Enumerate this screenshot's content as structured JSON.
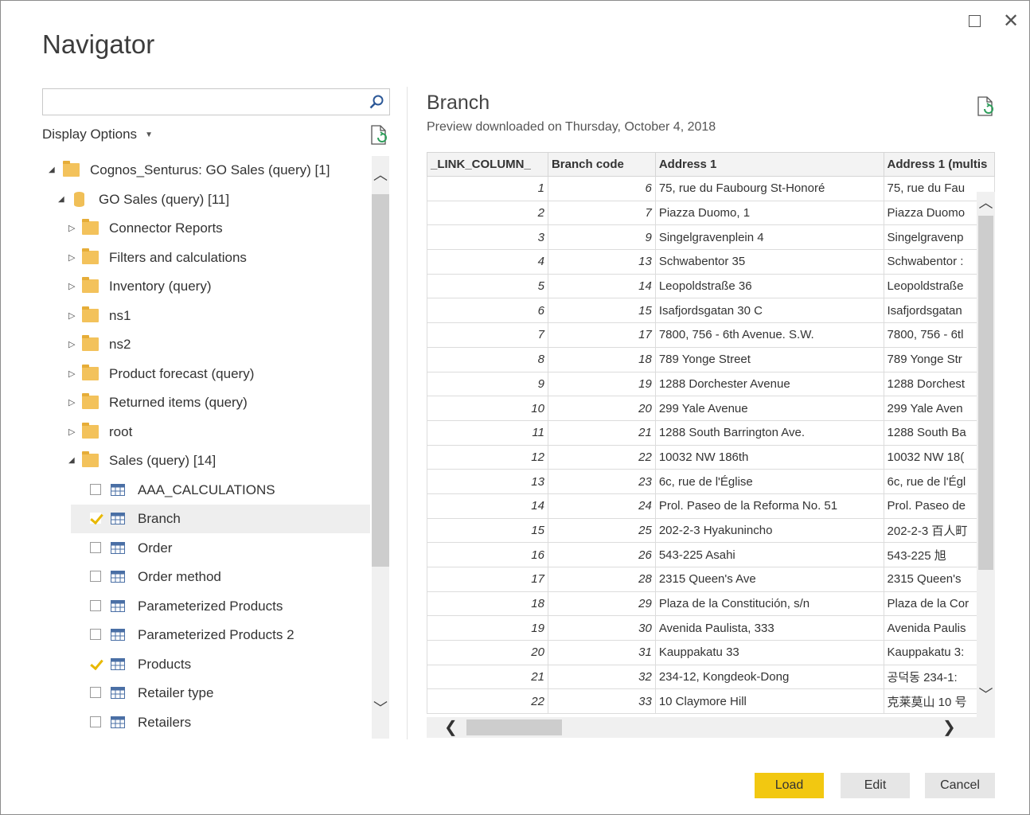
{
  "window": {
    "title": "Navigator",
    "maximize_icon": "maximize-icon",
    "close_icon": "close-icon",
    "close_glyph": "✕"
  },
  "left": {
    "search_placeholder": "",
    "display_options": "Display Options",
    "tree": {
      "root": "Cognos_Senturus: GO Sales (query) [1]",
      "db": "GO Sales (query) [11]",
      "folders": [
        "Connector Reports",
        "Filters and calculations",
        "Inventory (query)",
        "ns1",
        "ns2",
        "Product forecast (query)",
        "Returned items (query)",
        "root"
      ],
      "expanded_folder": "Sales (query) [14]",
      "tables": [
        {
          "label": "AAA_CALCULATIONS",
          "checked": false
        },
        {
          "label": "Branch",
          "checked": true
        },
        {
          "label": "Order",
          "checked": false
        },
        {
          "label": "Order method",
          "checked": false
        },
        {
          "label": "Parameterized Products",
          "checked": false
        },
        {
          "label": "Parameterized Products 2",
          "checked": false
        },
        {
          "label": "Products",
          "checked": true
        },
        {
          "label": "Retailer type",
          "checked": false
        },
        {
          "label": "Retailers",
          "checked": false
        }
      ]
    }
  },
  "preview": {
    "title": "Branch",
    "subtitle": "Preview downloaded on Thursday, October 4, 2018",
    "columns": [
      "_LINK_COLUMN_",
      "Branch code",
      "Address 1",
      "Address 1 (multis"
    ],
    "rows": [
      [
        "1",
        "6",
        "75, rue du Faubourg St-Honoré",
        "75, rue du Fau"
      ],
      [
        "2",
        "7",
        "Piazza Duomo, 1",
        "Piazza Duomo"
      ],
      [
        "3",
        "9",
        "Singelgravenplein 4",
        "Singelgravenp"
      ],
      [
        "4",
        "13",
        "Schwabentor 35",
        "Schwabentor :"
      ],
      [
        "5",
        "14",
        "Leopoldstraße 36",
        "Leopoldstraße"
      ],
      [
        "6",
        "15",
        "Isafjordsgatan 30 C",
        "Isafjordsgatan"
      ],
      [
        "7",
        "17",
        "7800, 756 - 6th Avenue. S.W.",
        "7800, 756 - 6tl"
      ],
      [
        "8",
        "18",
        "789 Yonge Street",
        "789 Yonge Str"
      ],
      [
        "9",
        "19",
        "1288 Dorchester Avenue",
        "1288 Dorchest"
      ],
      [
        "10",
        "20",
        "299 Yale Avenue",
        "299 Yale Aven"
      ],
      [
        "11",
        "21",
        "1288 South Barrington Ave.",
        "1288 South Ba"
      ],
      [
        "12",
        "22",
        "10032 NW 186th",
        "10032 NW 18("
      ],
      [
        "13",
        "23",
        "6c, rue de l'Église",
        "6c, rue de l'Égl"
      ],
      [
        "14",
        "24",
        "Prol. Paseo de la Reforma No. 51",
        "Prol. Paseo de"
      ],
      [
        "15",
        "25",
        "202-2-3 Hyakunincho",
        "202-2-3 百人町"
      ],
      [
        "16",
        "26",
        "543-225 Asahi",
        "543-225 旭"
      ],
      [
        "17",
        "28",
        "2315 Queen's Ave",
        "2315 Queen's"
      ],
      [
        "18",
        "29",
        "Plaza de la Constitución, s/n",
        "Plaza de la Cor"
      ],
      [
        "19",
        "30",
        "Avenida Paulista, 333",
        "Avenida Paulis"
      ],
      [
        "20",
        "31",
        "Kauppakatu 33",
        "Kauppakatu 3:"
      ],
      [
        "21",
        "32",
        "234-12, Kongdeok-Dong",
        "공덕동 234-1:"
      ],
      [
        "22",
        "33",
        "10 Claymore Hill",
        "克莱莫山 10 号"
      ]
    ]
  },
  "buttons": {
    "load": "Load",
    "edit": "Edit",
    "cancel": "Cancel"
  },
  "colors": {
    "accent": "#f2c811",
    "folder": "#f3c25b",
    "check": "#e8b800"
  }
}
